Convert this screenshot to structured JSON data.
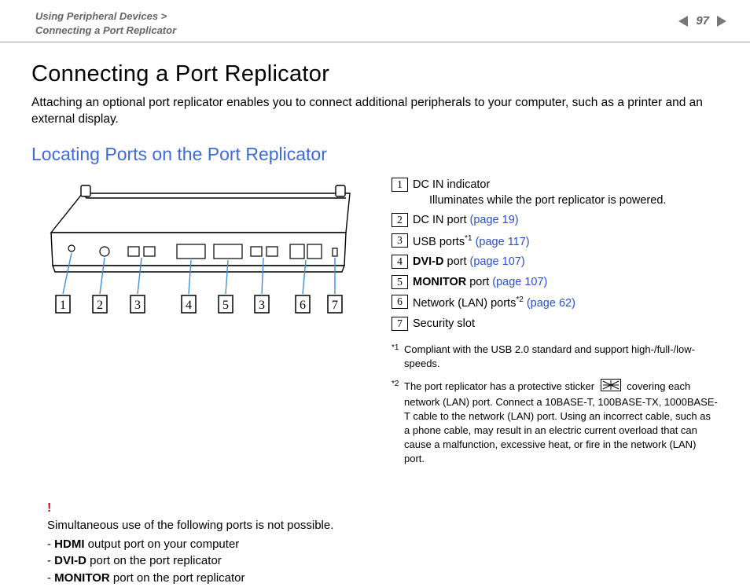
{
  "header": {
    "breadcrumb1": "Using Peripheral Devices >",
    "breadcrumb2": "Connecting a Port Replicator",
    "page_number": "97"
  },
  "title": "Connecting a Port Replicator",
  "intro": "Attaching an optional port replicator enables you to connect additional peripherals to your computer, such as a printer and an external display.",
  "subtitle": "Locating Ports on the Port Replicator",
  "callouts": [
    "1",
    "2",
    "3",
    "4",
    "5",
    "3",
    "6",
    "7"
  ],
  "legend": {
    "item1": {
      "label": "DC IN indicator",
      "sub": "Illuminates while the port replicator is powered."
    },
    "item2": {
      "label": "DC IN port ",
      "link": "(page 19)"
    },
    "item3": {
      "label": "USB ports",
      "sup": "*1",
      "link": " (page 117)"
    },
    "item4": {
      "bold": "DVI-D",
      "rest": " port ",
      "link": "(page 107)"
    },
    "item5": {
      "bold": "MONITOR",
      "rest": " port ",
      "link": "(page 107)"
    },
    "item6": {
      "label": "Network (LAN) ports",
      "sup": "*2",
      "link": " (page 62)"
    },
    "item7": {
      "label": "Security slot"
    }
  },
  "footnotes": {
    "f1_mark": "*1",
    "f1_text": "Compliant with the USB 2.0 standard and support high-/full-/low- speeds.",
    "f2_mark": "*2",
    "f2_pre": "The port replicator has a protective sticker ",
    "f2_post": " covering each network (LAN) port. Connect a 10BASE-T, 100BASE-TX, 1000BASE-T cable to the network (LAN) port. Using an incorrect cable, such as a phone cable, may result in an electric current overload that can cause a malfunction, excessive heat, or fire in the network (LAN) port."
  },
  "caution": {
    "bang": "!",
    "intro": "Simultaneous use of the following ports is not possible.",
    "items": {
      "l1_bold": "HDMI",
      "l1_rest": " output port on your computer",
      "l2_bold": "DVI-D",
      "l2_rest": " port on the port replicator",
      "l3_bold": "MONITOR",
      "l3_rest": " port on the port replicator"
    }
  }
}
